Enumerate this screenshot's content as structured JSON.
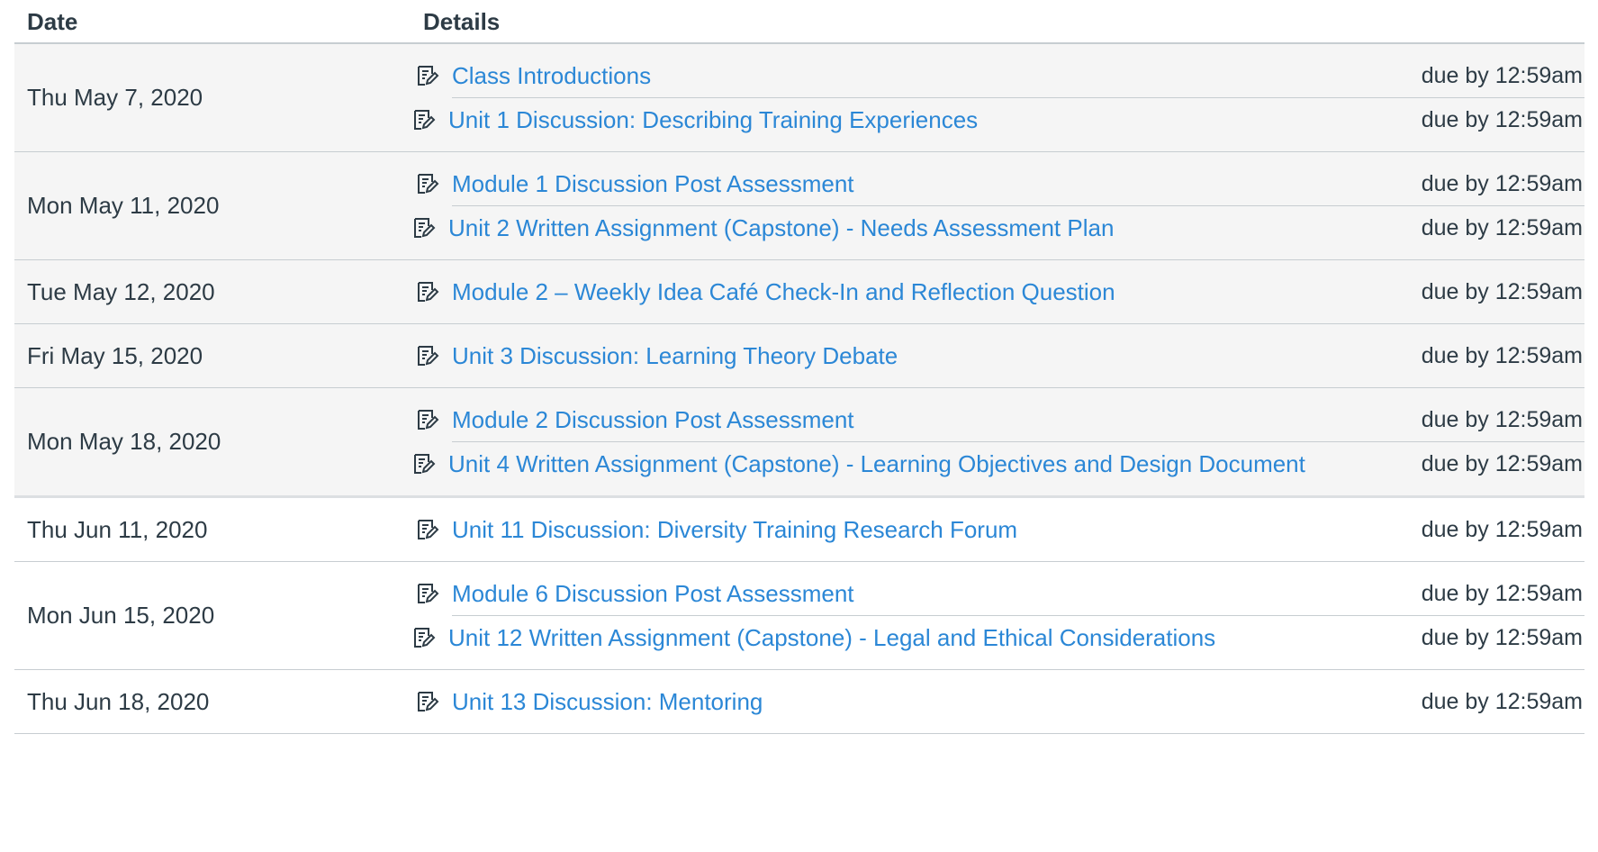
{
  "table": {
    "headers": {
      "date": "Date",
      "details": "Details"
    }
  },
  "groups": [
    {
      "date": "Thu May 7, 2020",
      "past": true,
      "items": [
        {
          "title": "Class Introductions",
          "due": "due by 12:59am",
          "icon": "discussion-icon"
        },
        {
          "title": "Unit 1 Discussion: Describing Training Experiences",
          "due": "due by 12:59am",
          "icon": "discussion-icon"
        }
      ]
    },
    {
      "date": "Mon May 11, 2020",
      "past": true,
      "items": [
        {
          "title": "Module 1 Discussion Post Assessment",
          "due": "due by 12:59am",
          "icon": "discussion-icon"
        },
        {
          "title": "Unit 2 Written Assignment (Capstone) - Needs Assessment Plan",
          "due": "due by 12:59am",
          "icon": "discussion-icon"
        }
      ]
    },
    {
      "date": "Tue May 12, 2020",
      "past": true,
      "items": [
        {
          "title": "Module 2 – Weekly Idea Café Check-In and Reflection Question",
          "due": "due by 12:59am",
          "icon": "discussion-icon"
        }
      ]
    },
    {
      "date": "Fri May 15, 2020",
      "past": true,
      "items": [
        {
          "title": "Unit 3 Discussion: Learning Theory Debate",
          "due": "due by 12:59am",
          "icon": "discussion-icon"
        }
      ]
    },
    {
      "date": "Mon May 18, 2020",
      "past": true,
      "items": [
        {
          "title": "Module 2 Discussion Post Assessment",
          "due": "due by 12:59am",
          "icon": "discussion-icon"
        },
        {
          "title": "Unit 4 Written Assignment (Capstone) - Learning Objectives and Design Document",
          "due": "due by 12:59am",
          "icon": "discussion-icon"
        }
      ]
    },
    {
      "date": "Thu Jun 11, 2020",
      "past": false,
      "items": [
        {
          "title": "Unit 11 Discussion: Diversity Training Research Forum",
          "due": "due by 12:59am",
          "icon": "discussion-icon"
        }
      ]
    },
    {
      "date": "Mon Jun 15, 2020",
      "past": false,
      "items": [
        {
          "title": "Module 6 Discussion Post Assessment",
          "due": "due by 12:59am",
          "icon": "discussion-icon"
        },
        {
          "title": "Unit 12 Written Assignment (Capstone) - Legal and Ethical Considerations",
          "due": "due by 12:59am",
          "icon": "discussion-icon"
        }
      ]
    },
    {
      "date": "Thu Jun 18, 2020",
      "past": false,
      "items": [
        {
          "title": "Unit 13 Discussion: Mentoring",
          "due": "due by 12:59am",
          "icon": "discussion-icon"
        }
      ]
    }
  ],
  "colors": {
    "link": "#2b87d6",
    "text": "#2d3b45",
    "past_row_bg": "#f5f5f5",
    "divider": "#c7cdd1"
  }
}
